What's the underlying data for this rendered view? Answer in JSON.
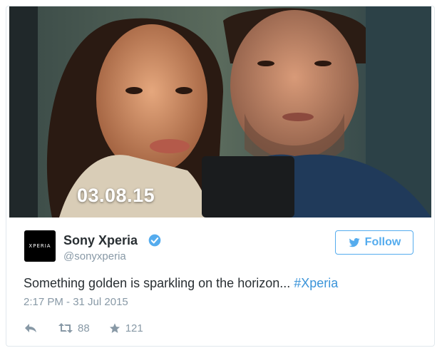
{
  "media": {
    "date_overlay": "03.08.15"
  },
  "avatar": {
    "text": "XPERIA"
  },
  "user": {
    "name": "Sony Xperia",
    "handle": "@sonyxperia"
  },
  "follow_button": {
    "label": "Follow"
  },
  "tweet": {
    "text": "Something golden is sparkling on the horizon... ",
    "hashtag": "#Xperia",
    "timestamp": "2:17 PM - 31 Jul 2015"
  },
  "actions": {
    "retweets": "88",
    "favorites": "121"
  },
  "colors": {
    "accent": "#55acee",
    "hashtag": "#3b94d9",
    "muted": "#8899a6",
    "text": "#292f33"
  },
  "icons": [
    "verified-icon",
    "twitter-bird-icon",
    "reply-icon",
    "retweet-icon",
    "favorite-star-icon"
  ]
}
